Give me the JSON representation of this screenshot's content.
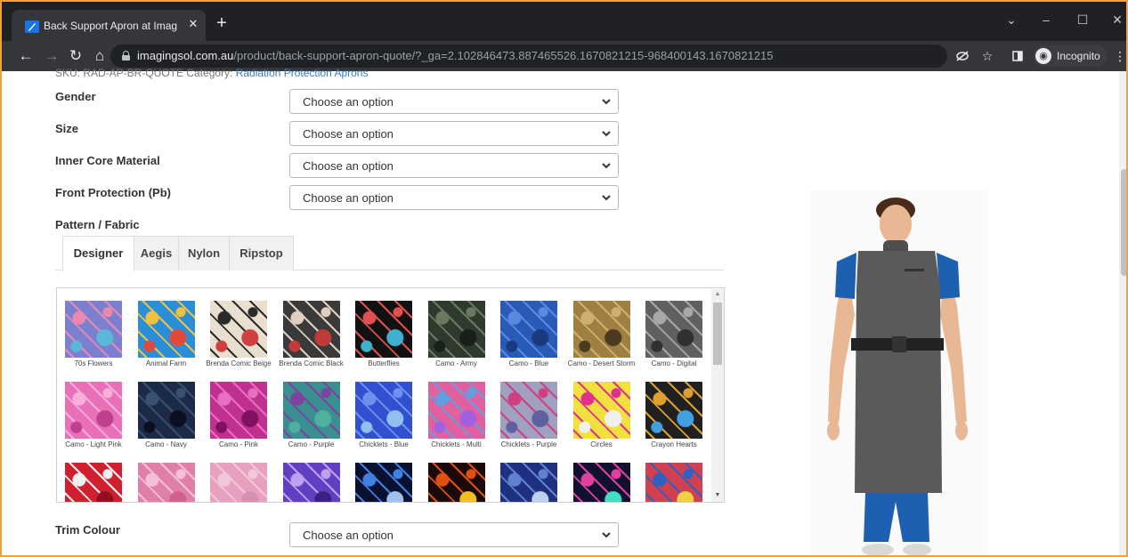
{
  "browser": {
    "tab_title": "Back Support Apron at Imaging S",
    "tab_close": "✕",
    "new_tab": "+",
    "url_host": "imagingsol.com.au",
    "url_path": "/product/back-support-apron-quote/?_ga=2.102846473.887465526.1670821215-968400143.1670821215",
    "incognito_label": "Incognito",
    "window_controls": [
      "⌄",
      "–",
      "☐",
      "✕"
    ]
  },
  "page": {
    "sku_text": "SKU: RAD-AP-BR-QUOTE Category: ",
    "category_link": "Radiation Protection Aprons",
    "fields": [
      {
        "label": "Gender",
        "value": "Choose an option"
      },
      {
        "label": "Size",
        "value": "Choose an option"
      },
      {
        "label": "Inner Core Material",
        "value": "Choose an option"
      },
      {
        "label": "Front Protection (Pb)",
        "value": "Choose an option"
      }
    ],
    "pattern_label": "Pattern / Fabric",
    "pattern_tabs": [
      "Designer",
      "Aegis",
      "Nylon",
      "Ripstop"
    ],
    "active_tab": "Designer",
    "swatches": [
      {
        "name": "70s Flowers",
        "c1": "#7b7fd0",
        "c2": "#e88ab0",
        "c3": "#5ab7d8"
      },
      {
        "name": "Animal Farm",
        "c1": "#2a8fd8",
        "c2": "#f0c040",
        "c3": "#e04a3a"
      },
      {
        "name": "Brenda Comic Beige",
        "c1": "#e9dfcf",
        "c2": "#2a2a2a",
        "c3": "#d04040"
      },
      {
        "name": "Brenda Comic Black",
        "c1": "#3a3a3a",
        "c2": "#e0d0c0",
        "c3": "#c03a3a"
      },
      {
        "name": "Butterflies",
        "c1": "#111111",
        "c2": "#e05050",
        "c3": "#40b0d0"
      },
      {
        "name": "Camo - Army",
        "c1": "#2e3a2e",
        "c2": "#6a7a60",
        "c3": "#1a1f1a"
      },
      {
        "name": "Camo - Blue",
        "c1": "#2a5ab8",
        "c2": "#5a8ae0",
        "c3": "#1a3a80"
      },
      {
        "name": "Camo - Desert Storm",
        "c1": "#a08040",
        "c2": "#d0b070",
        "c3": "#4a3a20"
      },
      {
        "name": "Camo - Digital",
        "c1": "#606060",
        "c2": "#a8a8a8",
        "c3": "#303030"
      },
      {
        "name": "Camo - Light Pink",
        "c1": "#e870b8",
        "c2": "#f8b0d8",
        "c3": "#c04090"
      },
      {
        "name": "Camo - Navy",
        "c1": "#1c2a48",
        "c2": "#3a5070",
        "c3": "#0a1020"
      },
      {
        "name": "Camo - Pink",
        "c1": "#c03090",
        "c2": "#e870c0",
        "c3": "#801060"
      },
      {
        "name": "Camo - Purple",
        "c1": "#3a9090",
        "c2": "#8040a0",
        "c3": "#50b0a0"
      },
      {
        "name": "Chicklets - Blue",
        "c1": "#3050d0",
        "c2": "#7090f0",
        "c3": "#90c0f0"
      },
      {
        "name": "Chicklets - Multi",
        "c1": "#e060a0",
        "c2": "#60a0e0",
        "c3": "#a060e0"
      },
      {
        "name": "Chicklets - Purple",
        "c1": "#a0a0c0",
        "c2": "#d04080",
        "c3": "#6060a0"
      },
      {
        "name": "Circles",
        "c1": "#f0e040",
        "c2": "#e03090",
        "c3": "#f0f0f0"
      },
      {
        "name": "Crayon Hearts",
        "c1": "#202020",
        "c2": "#e0a030",
        "c3": "#40a0e0"
      },
      {
        "name": "",
        "c1": "#d02030",
        "c2": "#f0f0f0",
        "c3": "#901020"
      },
      {
        "name": "",
        "c1": "#e080a8",
        "c2": "#f5c0d5",
        "c3": "#d06090"
      },
      {
        "name": "",
        "c1": "#e8a0c0",
        "c2": "#f0c8d8",
        "c3": "#d890b0"
      },
      {
        "name": "",
        "c1": "#6040c0",
        "c2": "#c0a0f0",
        "c3": "#3a2080"
      },
      {
        "name": "",
        "c1": "#0a1030",
        "c2": "#4080e0",
        "c3": "#a0c0f0"
      },
      {
        "name": "",
        "c1": "#1a0a0a",
        "c2": "#e05010",
        "c3": "#f0c020"
      },
      {
        "name": "",
        "c1": "#203080",
        "c2": "#6080d0",
        "c3": "#c0d0f0"
      },
      {
        "name": "",
        "c1": "#101030",
        "c2": "#e040a0",
        "c3": "#40e0c0"
      },
      {
        "name": "",
        "c1": "#d04050",
        "c2": "#3060c0",
        "c3": "#f0d040"
      }
    ],
    "trim_label": "Trim Colour",
    "trim_value": "Choose an option"
  },
  "colors": {
    "accent_border": "#f0a040",
    "link": "#3b7bbf",
    "apron": "#5a5a5a",
    "scrubs": "#1d5fb0"
  }
}
